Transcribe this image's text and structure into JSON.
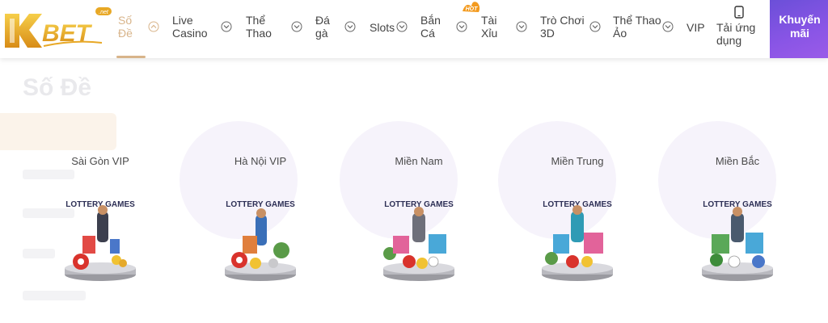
{
  "logo": {
    "brand": "KBET",
    "tld": ".net"
  },
  "nav": {
    "items": [
      {
        "label": "Số Đề",
        "active": true
      },
      {
        "label": "Live Casino"
      },
      {
        "label": "Thể Thao"
      },
      {
        "label": "Đá gà"
      },
      {
        "label": "Slots"
      },
      {
        "label": "Bắn Cá"
      },
      {
        "label": "Tài Xỉu",
        "badge": "HOT"
      },
      {
        "label": "Trò Chơi 3D"
      },
      {
        "label": "Thể Thao Ảo"
      },
      {
        "label": "VIP"
      }
    ],
    "download_label": "Tải ứng dụng",
    "promo_label": "Khuyến mãi"
  },
  "page": {
    "title": "Số Đề"
  },
  "games": [
    {
      "label": "Sài Gòn VIP",
      "art_text": "LOTTERY GAMES"
    },
    {
      "label": "Hà Nội VIP",
      "art_text": "LOTTERY GAMES"
    },
    {
      "label": "Miền Nam",
      "art_text": "LOTTERY GAMES"
    },
    {
      "label": "Miền Trung",
      "art_text": "LOTTERY GAMES"
    },
    {
      "label": "Miền Bắc",
      "art_text": "LOTTERY GAMES"
    }
  ],
  "colors": {
    "accent": "#d8b48a",
    "logo_gold": "#e8a825",
    "promo_start": "#6b4fd8",
    "promo_end": "#9a5be8",
    "text": "#444444"
  }
}
